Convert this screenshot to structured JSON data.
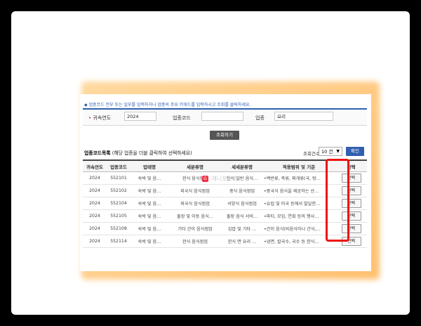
{
  "notice": "◆ 업종코드 전부 또는 일부를 입력하거나 업종의 주요 키워드를 입력하시고 조회를 클릭하세요.",
  "search": {
    "year_label": "귀속연도",
    "year_value": "2024",
    "code_label": "업종코드",
    "code_value": "",
    "industry_label": "업종",
    "industry_value": "요리"
  },
  "search_button": "조회하기",
  "list_title": "업종코드목록",
  "list_hint": "(해당 업종을 더블 클릭하여 선택하세요)",
  "count_label": "조회건수",
  "count_value": "10 건",
  "confirm_button": "확인",
  "table": {
    "headers": [
      "귀속연도",
      "업종코드",
      "업태명",
      "세분류명",
      "세세분류명",
      "적용범위 및 기준",
      "선택"
    ],
    "rows": [
      {
        "year": "2024",
        "code": "552101",
        "biz": "숙박 및 음…",
        "sub": "한식 음식점업",
        "subsub": "한식 일반 음식…",
        "scope": "•백반류, 죽류, 찌개류(국, 탕…",
        "select": "선택"
      },
      {
        "year": "2024",
        "code": "552102",
        "biz": "숙박 및 음…",
        "sub": "외국식 음식점업",
        "subsub": "중식 음식점업",
        "scope": "•중국식 음식을 제공하는 산…",
        "select": "선택"
      },
      {
        "year": "2024",
        "code": "552104",
        "biz": "숙박 및 음…",
        "sub": "외국식 음식점업",
        "subsub": "서양식 음식점업",
        "scope": "•유럽 및 미국 등에서 발달한…",
        "select": "선택"
      },
      {
        "year": "2024",
        "code": "552105",
        "biz": "숙박 및 음…",
        "sub": "출장 및 이동 음식…",
        "subsub": "출장 음식 서비…",
        "scope": "•파티, 모임, 연회 등의 행사…",
        "select": "선택"
      },
      {
        "year": "2024",
        "code": "552108",
        "biz": "숙박 및 음…",
        "sub": "기타 간이 음식점업",
        "subsub": "김밥 및 기타 …",
        "scope": "•간이 음식(비음식이나 간식,…",
        "select": "선택"
      },
      {
        "year": "2024",
        "code": "552114",
        "biz": "숙박 및 음…",
        "sub": "한식 음식점업",
        "subsub": "한식 면 요리 …",
        "scope": "•냉면, 칼국수, 국수 등 한식…",
        "select": "선택"
      }
    ]
  },
  "watermark": "게니포스트",
  "watermark_logo": "G"
}
